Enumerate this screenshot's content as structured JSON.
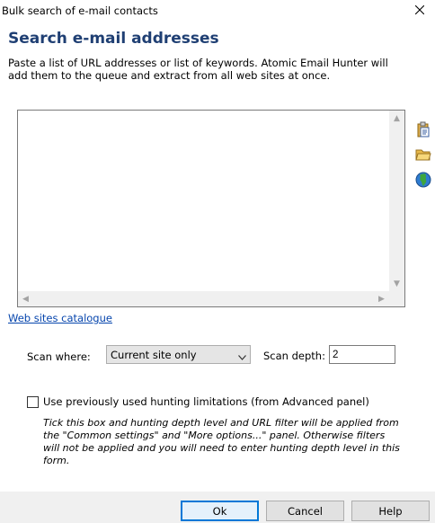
{
  "window": {
    "title": "Bulk search of e-mail contacts",
    "close_icon": "close-icon"
  },
  "header": {
    "title": "Search e-mail addresses",
    "description": "Paste a list of URL addresses or list of keywords. Atomic Email Hunter will add them to the queue and extract from all web sites at once."
  },
  "url_list": {
    "value": ""
  },
  "side_icons": [
    "clipboard-paste-icon",
    "open-folder-icon",
    "globe-icon"
  ],
  "catalogue_link": "Web sites catalogue",
  "scan": {
    "where_label": "Scan where:",
    "where_value": "Current site only",
    "depth_label": "Scan depth:",
    "depth_value": "2"
  },
  "limitations": {
    "checkbox_label": "Use previously used hunting limitations (from Advanced panel)",
    "checked": false,
    "hint": "Tick this box and hunting depth level and URL filter will be applied from the \"Common settings\" and \"More options...\" panel. Otherwise filters will not be applied and you will need to enter hunting depth level in this form."
  },
  "buttons": {
    "ok": "Ok",
    "cancel": "Cancel",
    "help": "Help"
  }
}
